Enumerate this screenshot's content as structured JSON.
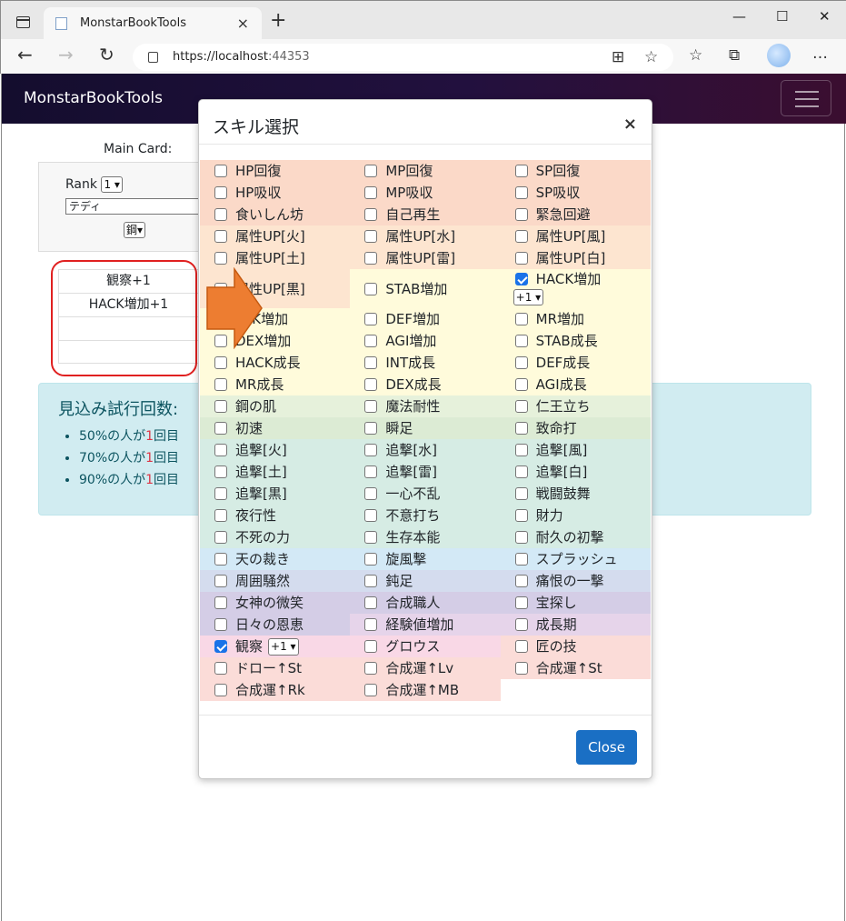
{
  "browser": {
    "tab_title": "MonstarBookTools",
    "tab_close": "×",
    "new_tab": "+",
    "url_scheme": "https://",
    "url_host": "localhost",
    "url_port": ":44353",
    "win_min": "—",
    "win_max": "☐",
    "win_close": "✕"
  },
  "navbar": {
    "brand": "MonstarBookTools"
  },
  "main": {
    "main_card_label": "Main Card:",
    "rank_label": "Rank",
    "rank_value": "1",
    "card_name": "テディ",
    "card_material": "鋼",
    "selected_skills": [
      "観察+1",
      "HACK増加+1",
      "",
      ""
    ],
    "estimate_title": "見込み試行回数:",
    "estimates": [
      {
        "pre": "50%の人が",
        "num": "1",
        "post": "回目"
      },
      {
        "pre": "70%の人が",
        "num": "1",
        "post": "回目"
      },
      {
        "pre": "90%の人が",
        "num": "1",
        "post": "回目"
      }
    ]
  },
  "modal": {
    "title": "スキル選択",
    "close_x": "×",
    "close_button": "Close",
    "rows": [
      {
        "bg": [
          "#fbd9c8",
          "#fbd9c8",
          "#fbd9c8"
        ],
        "cells": [
          {
            "label": "HP回復",
            "checked": false
          },
          {
            "label": "MP回復",
            "checked": false
          },
          {
            "label": "SP回復",
            "checked": false
          }
        ]
      },
      {
        "bg": [
          "#fbd9c8",
          "#fbd9c8",
          "#fbd9c8"
        ],
        "cells": [
          {
            "label": "HP吸収",
            "checked": false
          },
          {
            "label": "MP吸収",
            "checked": false
          },
          {
            "label": "SP吸収",
            "checked": false
          }
        ]
      },
      {
        "bg": [
          "#fbd9c8",
          "#fbd9c8",
          "#fbd9c8"
        ],
        "cells": [
          {
            "label": "食いしん坊",
            "checked": false
          },
          {
            "label": "自己再生",
            "checked": false
          },
          {
            "label": "緊急回避",
            "checked": false
          }
        ]
      },
      {
        "bg": [
          "#fde5d0",
          "#fde5d0",
          "#fde5d0"
        ],
        "cells": [
          {
            "label": "属性UP[火]",
            "checked": false
          },
          {
            "label": "属性UP[水]",
            "checked": false
          },
          {
            "label": "属性UP[風]",
            "checked": false
          }
        ]
      },
      {
        "bg": [
          "#fde5d0",
          "#fde5d0",
          "#fde5d0"
        ],
        "cells": [
          {
            "label": "属性UP[土]",
            "checked": false
          },
          {
            "label": "属性UP[雷]",
            "checked": false
          },
          {
            "label": "属性UP[白]",
            "checked": false
          }
        ]
      },
      {
        "bg": [
          "#fde5d0",
          "#fffbdb",
          "#fffbdb"
        ],
        "tall": true,
        "cells": [
          {
            "label": "属性UP[黒]",
            "checked": false
          },
          {
            "label": "STAB増加",
            "checked": false
          },
          {
            "label": "HACK増加",
            "checked": true,
            "level": "+1"
          }
        ]
      },
      {
        "bg": [
          "#fffbdb",
          "#fffbdb",
          "#fffbdb"
        ],
        "cells": [
          {
            "label": "ATK増加",
            "checked": false
          },
          {
            "label": "DEF増加",
            "checked": false
          },
          {
            "label": "MR増加",
            "checked": false
          }
        ]
      },
      {
        "bg": [
          "#fffbdb",
          "#fffbdb",
          "#fffbdb"
        ],
        "cells": [
          {
            "label": "DEX増加",
            "checked": false
          },
          {
            "label": "AGI増加",
            "checked": false
          },
          {
            "label": "STAB成長",
            "checked": false
          }
        ]
      },
      {
        "bg": [
          "#fffbdb",
          "#fffbdb",
          "#fffbdb"
        ],
        "cells": [
          {
            "label": "HACK成長",
            "checked": false
          },
          {
            "label": "INT成長",
            "checked": false
          },
          {
            "label": "DEF成長",
            "checked": false
          }
        ]
      },
      {
        "bg": [
          "#fffbdb",
          "#fffbdb",
          "#fffbdb"
        ],
        "cells": [
          {
            "label": "MR成長",
            "checked": false
          },
          {
            "label": "DEX成長",
            "checked": false
          },
          {
            "label": "AGI成長",
            "checked": false
          }
        ]
      },
      {
        "bg": [
          "#e6f1db",
          "#e6f1db",
          "#e6f1db"
        ],
        "cells": [
          {
            "label": "鋼の肌",
            "checked": false
          },
          {
            "label": "魔法耐性",
            "checked": false
          },
          {
            "label": "仁王立ち",
            "checked": false
          }
        ]
      },
      {
        "bg": [
          "#dcebd4",
          "#dcebd4",
          "#dcebd4"
        ],
        "cells": [
          {
            "label": "初速",
            "checked": false
          },
          {
            "label": "瞬足",
            "checked": false
          },
          {
            "label": "致命打",
            "checked": false
          }
        ]
      },
      {
        "bg": [
          "#d6ece4",
          "#d6ece4",
          "#d6ece4"
        ],
        "cells": [
          {
            "label": "追撃[火]",
            "checked": false
          },
          {
            "label": "追撃[水]",
            "checked": false
          },
          {
            "label": "追撃[風]",
            "checked": false
          }
        ]
      },
      {
        "bg": [
          "#d6ece4",
          "#d6ece4",
          "#d6ece4"
        ],
        "cells": [
          {
            "label": "追撃[土]",
            "checked": false
          },
          {
            "label": "追撃[雷]",
            "checked": false
          },
          {
            "label": "追撃[白]",
            "checked": false
          }
        ]
      },
      {
        "bg": [
          "#d6ece4",
          "#d6ece4",
          "#d6ece4"
        ],
        "cells": [
          {
            "label": "追撃[黒]",
            "checked": false
          },
          {
            "label": "一心不乱",
            "checked": false
          },
          {
            "label": "戦闘鼓舞",
            "checked": false
          }
        ]
      },
      {
        "bg": [
          "#d6ece4",
          "#d6ece4",
          "#d6ece4"
        ],
        "cells": [
          {
            "label": "夜行性",
            "checked": false
          },
          {
            "label": "不意打ち",
            "checked": false
          },
          {
            "label": "財力",
            "checked": false
          }
        ]
      },
      {
        "bg": [
          "#d6ece4",
          "#d6ece4",
          "#d6ece4"
        ],
        "cells": [
          {
            "label": "不死の力",
            "checked": false
          },
          {
            "label": "生存本能",
            "checked": false
          },
          {
            "label": "耐久の初撃",
            "checked": false
          }
        ]
      },
      {
        "bg": [
          "#d3e9f6",
          "#d3e9f6",
          "#d3e9f6"
        ],
        "cells": [
          {
            "label": "天の裁き",
            "checked": false
          },
          {
            "label": "旋風撃",
            "checked": false
          },
          {
            "label": "スプラッシュ",
            "checked": false
          }
        ]
      },
      {
        "bg": [
          "#d4dcee",
          "#d4dcee",
          "#d4dcee"
        ],
        "cells": [
          {
            "label": "周囲騒然",
            "checked": false
          },
          {
            "label": "鈍足",
            "checked": false
          },
          {
            "label": "痛恨の一撃",
            "checked": false
          }
        ]
      },
      {
        "bg": [
          "#d4cde6",
          "#d4cde6",
          "#d4cde6"
        ],
        "cells": [
          {
            "label": "女神の微笑",
            "checked": false
          },
          {
            "label": "合成職人",
            "checked": false
          },
          {
            "label": "宝探し",
            "checked": false
          }
        ]
      },
      {
        "bg": [
          "#d4cde6",
          "#e6d4ea",
          "#e6d4ea"
        ],
        "cells": [
          {
            "label": "日々の恩恵",
            "checked": false
          },
          {
            "label": "経験値増加",
            "checked": false
          },
          {
            "label": "成長期",
            "checked": false
          }
        ]
      },
      {
        "bg": [
          "#f9d8e6",
          "#f9d8e6",
          "#fbdcd8"
        ],
        "cells": [
          {
            "label": "観察",
            "checked": true,
            "level": "+1"
          },
          {
            "label": "グロウス",
            "checked": false
          },
          {
            "label": "匠の技",
            "checked": false
          }
        ]
      },
      {
        "bg": [
          "#fbdcd8",
          "#fbdcd8",
          "#fbdcd8"
        ],
        "cells": [
          {
            "label": "ドロー↑St",
            "checked": false
          },
          {
            "label": "合成運↑Lv",
            "checked": false
          },
          {
            "label": "合成運↑St",
            "checked": false
          }
        ]
      },
      {
        "bg": [
          "#fbdcd8",
          "#fbdcd8",
          ""
        ],
        "cells": [
          {
            "label": "合成運↑Rk",
            "checked": false
          },
          {
            "label": "合成運↑MB",
            "checked": false
          },
          null
        ]
      }
    ]
  },
  "colors": {
    "arrow": "#ed7d31",
    "arrow_stroke": "#c55a11",
    "highlight_border": "#e02020",
    "primary": "#1a6fc4"
  }
}
